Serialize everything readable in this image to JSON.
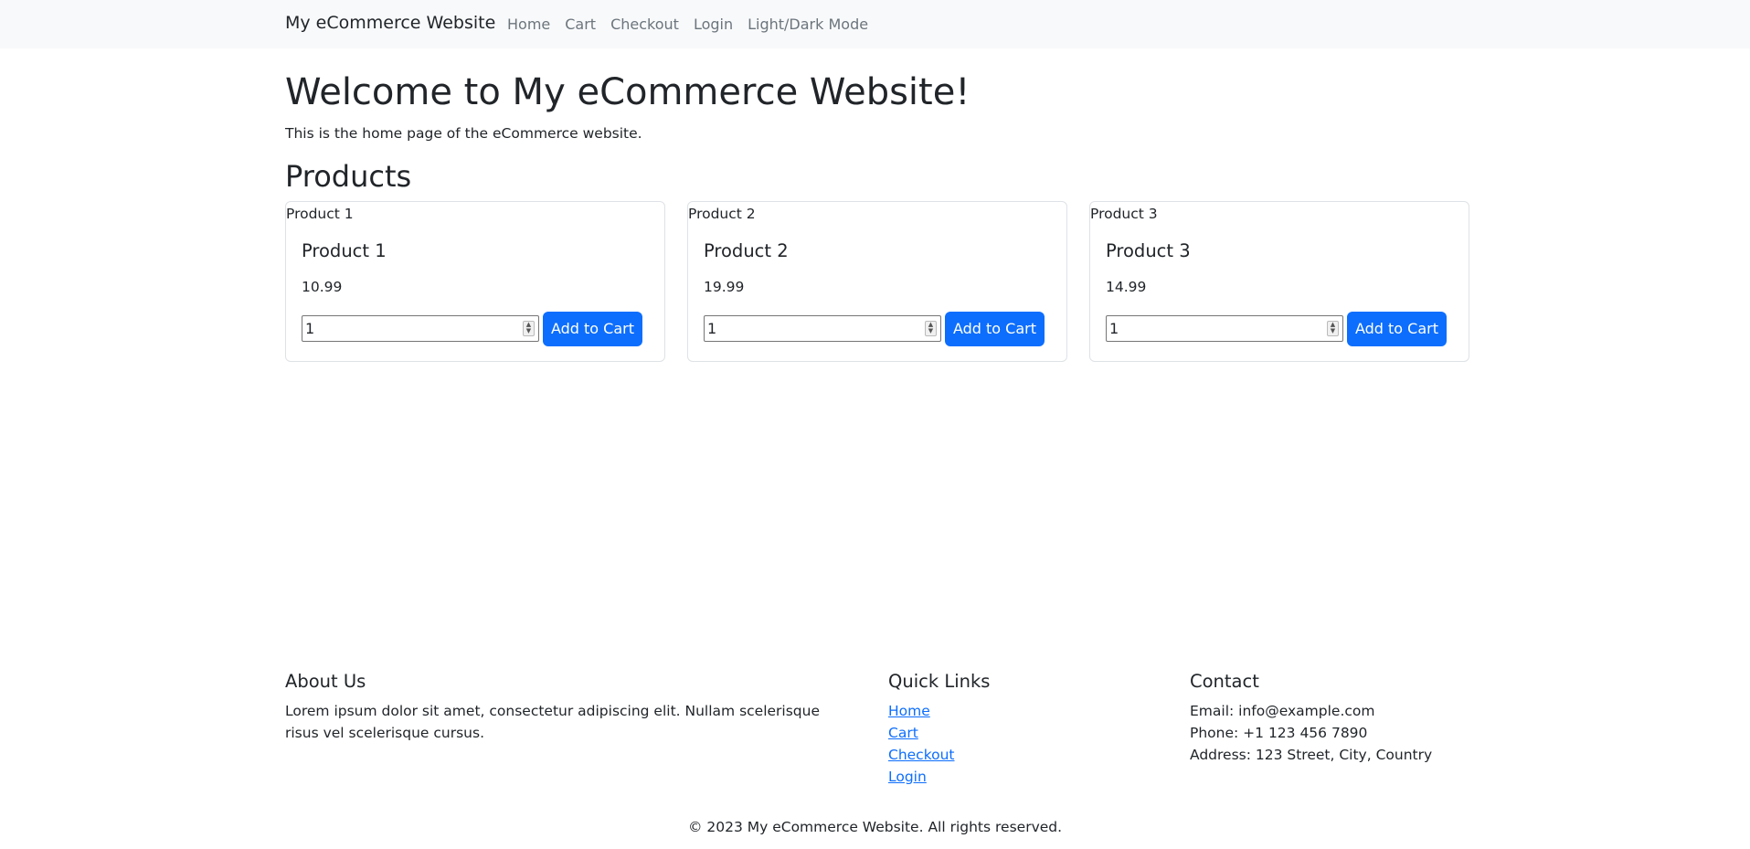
{
  "nav": {
    "brand": "My eCommerce Website",
    "links": [
      "Home",
      "Cart",
      "Checkout",
      "Login",
      "Light/Dark Mode"
    ]
  },
  "main": {
    "title": "Welcome to My eCommerce Website!",
    "intro": "This is the home page of the eCommerce website.",
    "products_heading": "Products"
  },
  "products": [
    {
      "image_alt": "Product 1",
      "name": "Product 1",
      "price": "10.99",
      "qty": "1",
      "button": "Add to Cart"
    },
    {
      "image_alt": "Product 2",
      "name": "Product 2",
      "price": "19.99",
      "qty": "1",
      "button": "Add to Cart"
    },
    {
      "image_alt": "Product 3",
      "name": "Product 3",
      "price": "14.99",
      "qty": "1",
      "button": "Add to Cart"
    }
  ],
  "footer": {
    "about_title": "About Us",
    "about_text": "Lorem ipsum dolor sit amet, consectetur adipiscing elit. Nullam scelerisque risus vel scelerisque cursus.",
    "links_title": "Quick Links",
    "links": [
      "Home",
      "Cart",
      "Checkout",
      "Login"
    ],
    "contact_title": "Contact",
    "email": "Email: info@example.com",
    "phone": "Phone: +1 123 456 7890",
    "address": "Address: 123 Street, City, Country",
    "copyright": "© 2023 My eCommerce Website. All rights reserved."
  },
  "colors": {
    "primary": "#0d6efd",
    "navbar_bg": "#f8f9fa",
    "text": "#212529",
    "muted": "#6c757d"
  },
  "icons": {
    "qty_spinner": "spinner-arrows-icon"
  }
}
